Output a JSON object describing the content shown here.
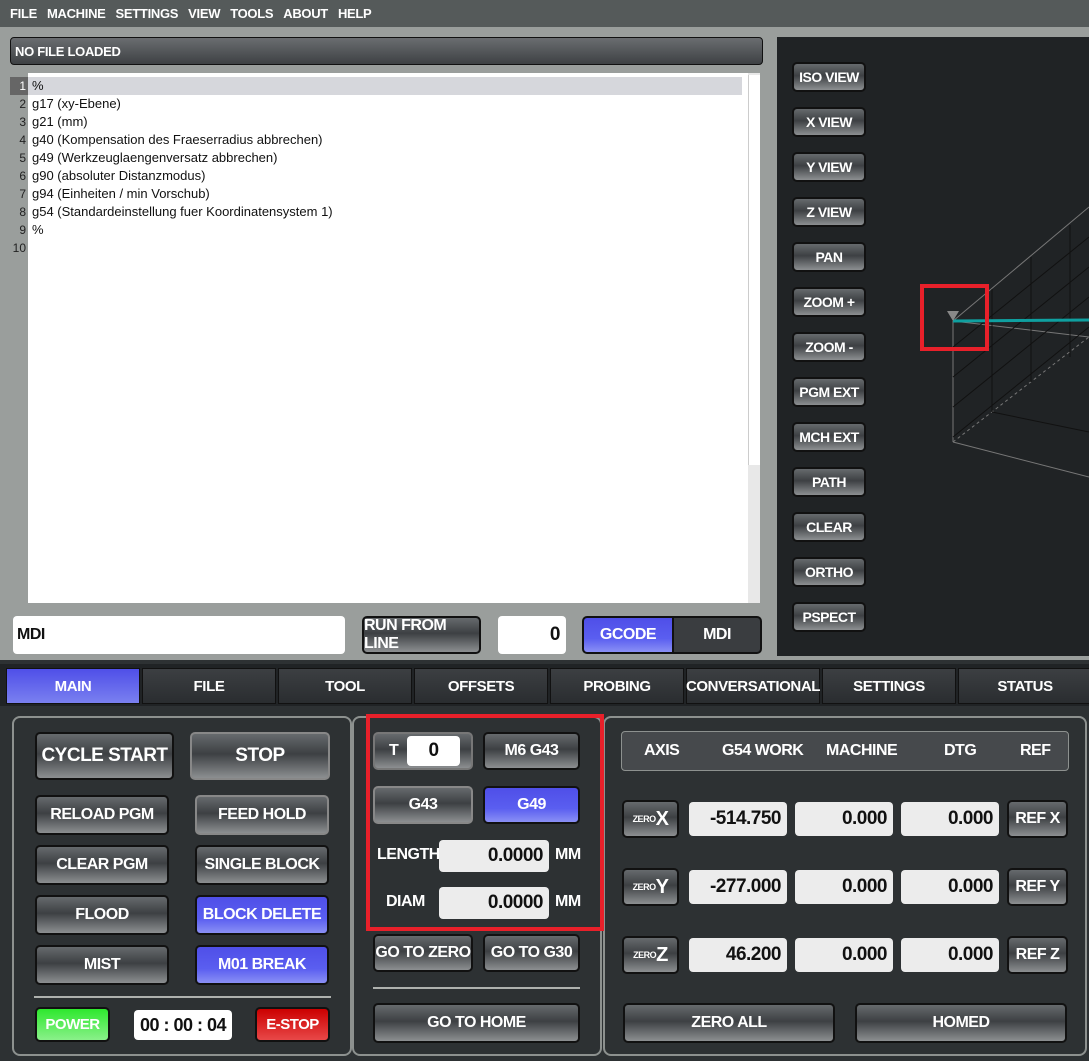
{
  "menu": [
    "FILE",
    "MACHINE",
    "SETTINGS",
    "VIEW",
    "TOOLS",
    "ABOUT",
    "HELP"
  ],
  "file_label": "NO FILE LOADED",
  "editor": {
    "line_numbers": [
      "1",
      "2",
      "3",
      "4",
      "5",
      "6",
      "7",
      "8",
      "9",
      "10"
    ],
    "lines": [
      "%",
      "g17 (xy-Ebene)",
      "g21 (mm)",
      "g40 (Kompensation des Fraeserradius abbrechen)",
      "g49 (Werkzeuglaengenversatz abbrechen)",
      "g90 (absoluter Distanzmodus)",
      "g94 (Einheiten / min Vorschub)",
      "g54 (Standardeinstellung fuer Koordinatensystem 1)",
      "%",
      ""
    ]
  },
  "mdi_input": "MDI",
  "run_from_line": "RUN FROM LINE",
  "line_value": "0",
  "mode": {
    "gcode": "GCODE",
    "mdi": "MDI"
  },
  "view_buttons": [
    "ISO VIEW",
    "X VIEW",
    "Y VIEW",
    "Z VIEW",
    "PAN",
    "ZOOM +",
    "ZOOM -",
    "PGM EXT",
    "MCH EXT",
    "PATH",
    "CLEAR",
    "ORTHO",
    "PSPECT"
  ],
  "tabs": [
    "MAIN",
    "FILE",
    "TOOL",
    "OFFSETS",
    "PROBING",
    "CONVERSATIONAL",
    "SETTINGS",
    "STATUS"
  ],
  "controls": {
    "cycle_start": "CYCLE START",
    "stop": "STOP",
    "reload": "RELOAD PGM",
    "feed_hold": "FEED HOLD",
    "clear": "CLEAR PGM",
    "single_block": "SINGLE BLOCK",
    "flood": "FLOOD",
    "block_delete": "BLOCK DELETE",
    "mist": "MIST",
    "m01": "M01 BREAK",
    "power": "POWER",
    "timer": "00 : 00 : 04",
    "estop": "E-STOP"
  },
  "tool": {
    "t_label": "T",
    "t_value": "0",
    "m6": "M6 G43",
    "g43": "G43",
    "g49": "G49",
    "length_label": "LENGTH",
    "length": "0.0000",
    "diam_label": "DIAM",
    "diam": "0.0000",
    "unit": "MM",
    "go_zero": "GO TO ZERO",
    "go_g30": "GO TO G30",
    "go_home": "GO TO HOME"
  },
  "dro": {
    "headers": [
      "AXIS",
      "G54 WORK",
      "MACHINE",
      "DTG",
      "REF"
    ],
    "zero_label": "ZERO",
    "rows": [
      {
        "axis": "X",
        "work": "-514.750",
        "machine": "0.000",
        "dtg": "0.000",
        "ref": "REF X"
      },
      {
        "axis": "Y",
        "work": "-277.000",
        "machine": "0.000",
        "dtg": "0.000",
        "ref": "REF Y"
      },
      {
        "axis": "Z",
        "work": "46.200",
        "machine": "0.000",
        "dtg": "0.000",
        "ref": "REF Z"
      }
    ],
    "zero_all": "ZERO ALL",
    "homed": "HOMED"
  },
  "colors": {
    "accent": "#5a5ef0",
    "power": "#3ee83e",
    "estop": "#d01010",
    "highlight": "#e8202a",
    "path": "#0fa0a0"
  }
}
